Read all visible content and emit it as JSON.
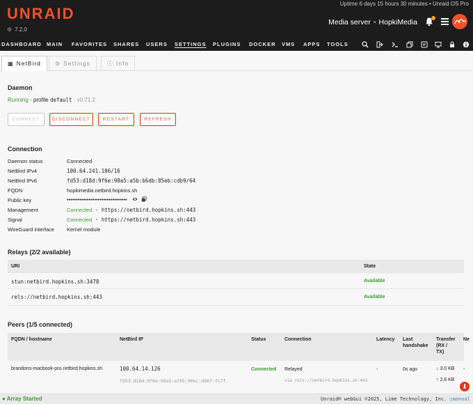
{
  "header": {
    "logo": "UNRAID",
    "version": "7.2.0",
    "uptime": "Uptime 6 days 15 hours 30 minutes",
    "os_label": "Unraid OS Pro",
    "server_description": "Media server",
    "server_name": "HopkiMedia"
  },
  "nav": {
    "items": [
      "DASHBOARD",
      "MAIN",
      "FAVORITES",
      "SHARES",
      "USERS",
      "SETTINGS",
      "PLUGINS",
      "DOCKER",
      "VMS",
      "APPS",
      "TOOLS"
    ],
    "active": "SETTINGS",
    "icons": [
      "search-icon",
      "logout-icon",
      "terminal-icon",
      "copy-icon",
      "feedback-icon",
      "display-icon",
      "lock-icon",
      "info-icon"
    ]
  },
  "tabs": [
    {
      "label": "NetBird",
      "icon": "grid-icon"
    },
    {
      "label": "Settings",
      "icon": "gears-icon"
    },
    {
      "label": "Info",
      "icon": "info-icon"
    }
  ],
  "daemon": {
    "title": "Daemon",
    "status": "Running",
    "profile_prefix": " · profile ",
    "profile": "default",
    "version": " · v0.71.2",
    "buttons": {
      "connect": "CONNECT",
      "disconnect": "DISCONNECT",
      "restart": "RESTART",
      "refresh": "REFRESH"
    }
  },
  "connection": {
    "title": "Connection",
    "rows": [
      {
        "label": "Daemon status",
        "value": "Connected"
      },
      {
        "label": "NetBird IPv4",
        "value": "100.64.241.106/16"
      },
      {
        "label": "NetBird IPv6",
        "value": "fd53:d18d:9f6e:98a5:a5b:b6db:85eb:cdb9/64"
      },
      {
        "label": "FQDN",
        "value": "hopkimedia.netbird.hopkins.sh"
      },
      {
        "label": "Public key",
        "value": "•••••••••••••••••••••••••••••••••"
      },
      {
        "label": "Management",
        "status": "Connected",
        "value": " · https://netbird.hopkins.sh:443"
      },
      {
        "label": "Signal",
        "status": "Connected",
        "value": " · https://netbird.hopkins.sh:443"
      },
      {
        "label": "WireGuard interface",
        "value": "Kernel module"
      }
    ]
  },
  "relays": {
    "title": "Relays (2/2 available)",
    "headers": {
      "uri": "URI",
      "state": "State"
    },
    "rows": [
      {
        "uri": "stun:netbird.hopkins.sh:3478",
        "state": "Available"
      },
      {
        "uri": "rels://netbird.hopkins.sh:443",
        "state": "Available"
      }
    ]
  },
  "peers": {
    "title": "Peers (1/5 connected)",
    "headers": {
      "fqdn": "FQDN / hostname",
      "ip": "NetBird IP",
      "status": "Status",
      "connection": "Connection",
      "latency": "Latency",
      "handshake_1": "Last",
      "handshake_2": "handshake",
      "transfer_1": "Transfer",
      "transfer_2": "(RX /",
      "transfer_3": "TX)",
      "extra": "Ne"
    },
    "rows": [
      {
        "fqdn": "brandons-macbook-pro.netbird.hopkins.sh",
        "ipv4": "100.64.14.126",
        "ipv6": "fd53:d18d:9f6e:98a5:a705:90ec:d867:fc7f",
        "status": "Connected",
        "connection": "Relayed",
        "via": "via rels://netbird.hopkins.sh:443",
        "latency": "-",
        "handshake": "0s ago",
        "rx": "↓ 3.0 KB",
        "tx": "↑ 2.6 KB",
        "extra": "-"
      }
    ]
  },
  "footer": {
    "array_status": "Array Started",
    "copyright": "Unraid® webGui ©2025, Lime Technology, Inc.",
    "manual": "manual"
  },
  "colors": {
    "accent": "#f2512b",
    "success": "#3c9a2f",
    "header_bg": "#1c1c1c"
  }
}
